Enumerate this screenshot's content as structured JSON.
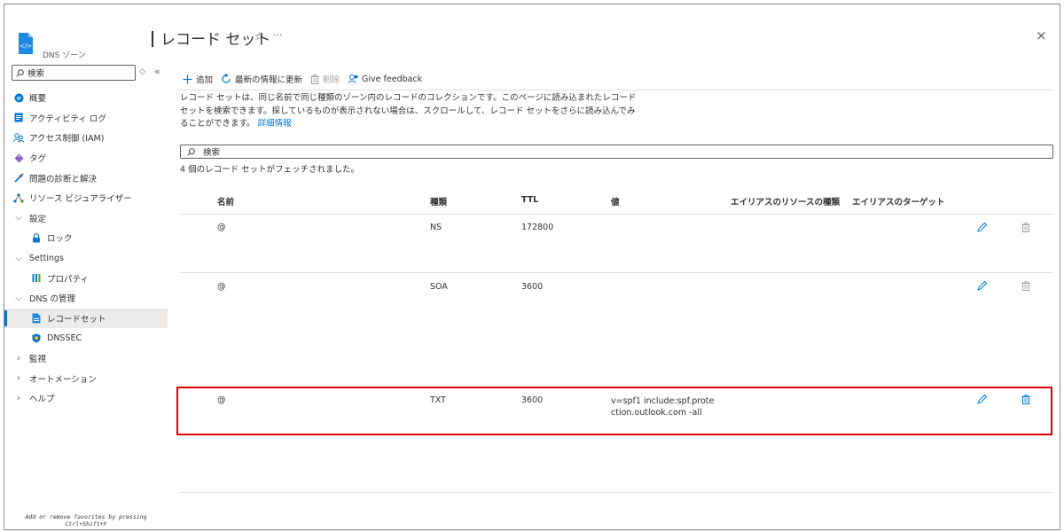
{
  "resource": {
    "type": "DNS ゾーン"
  },
  "page": {
    "title": "レコード セット",
    "close_label": "×",
    "more_label": "···",
    "star_label": "☆"
  },
  "sidebar": {
    "search_placeholder": "検索",
    "items": [
      {
        "label": "概要",
        "icon": "overview-icon"
      },
      {
        "label": "アクティビティ ログ",
        "icon": "activity-log-icon"
      },
      {
        "label": "アクセス制御 (IAM)",
        "icon": "iam-icon"
      },
      {
        "label": "タグ",
        "icon": "tag-icon"
      },
      {
        "label": "問題の診断と解決",
        "icon": "wrench-icon"
      },
      {
        "label": "リソース ビジュアライザー",
        "icon": "visualizer-icon"
      },
      {
        "label": "設定",
        "expanded": true
      },
      {
        "label": "ロック",
        "icon": "lock-icon"
      },
      {
        "label": "Settings",
        "expanded": true
      },
      {
        "label": "プロパティ",
        "icon": "properties-icon"
      },
      {
        "label": "DNS の管理",
        "expanded": true
      },
      {
        "label": "レコードセット",
        "icon": "record-set-icon",
        "active": true
      },
      {
        "label": "DNSSEC",
        "icon": "shield-icon"
      },
      {
        "label": "監視",
        "expanded": false
      },
      {
        "label": "オートメーション",
        "expanded": false
      },
      {
        "label": "ヘルプ",
        "expanded": false
      }
    ],
    "favorites_hint_line1": "Add or remove favorites by pressing",
    "favorites_hint_line2": "Ctrl+Shift+F"
  },
  "toolbar": {
    "add": "追加",
    "refresh": "最新の情報に更新",
    "delete": "削除",
    "feedback": "Give feedback"
  },
  "description": {
    "text": "レコード セットは、同じ名前で同じ種類のゾーン内のレコードのコレクションです。このページに読み込まれたレコード セットを検索できます。探しているものが表示されない場合は、スクロールして、レコード セットをさらに読み込んでみることができます。",
    "link": "詳細情報"
  },
  "search": {
    "placeholder": "検索"
  },
  "fetched_text": "4 個のレコード セットがフェッチされました。",
  "table": {
    "headers": {
      "name": "名前",
      "type": "種類",
      "ttl": "TTL",
      "value": "値",
      "alias_type": "エイリアスのリソースの種類",
      "alias_target": "エイリアスのターゲット"
    },
    "rows": [
      {
        "name": "@",
        "type": "NS",
        "ttl": "172800",
        "value": ""
      },
      {
        "name": "@",
        "type": "SOA",
        "ttl": "3600",
        "value": ""
      },
      {
        "name": "@",
        "type": "TXT",
        "ttl": "3600",
        "value": "v=spf1 include:spf.protection.outlook.com -all"
      }
    ]
  },
  "colors": {
    "accent": "#0078d4",
    "highlight": "#e00000"
  }
}
